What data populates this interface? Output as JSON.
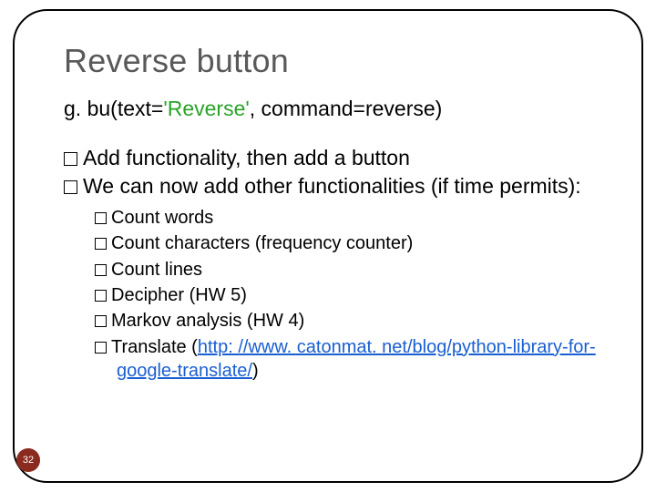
{
  "title": "Reverse button",
  "code": {
    "pre": "g. bu(text=",
    "str": "'Reverse'",
    "post": ", command=reverse)"
  },
  "bullets": [
    "Add functionality, then add a button",
    "We can now add other functionalities (if time permits):"
  ],
  "subbullets": [
    "Count words",
    "Count characters (frequency counter)",
    "Count lines",
    "Decipher (HW 5)",
    "Markov analysis (HW 4)"
  ],
  "translate": {
    "label": "Translate (",
    "url": "http: //www. catonmat. net/blog/python-library-for-google-translate/",
    "close": ")"
  },
  "pagenum": "32"
}
